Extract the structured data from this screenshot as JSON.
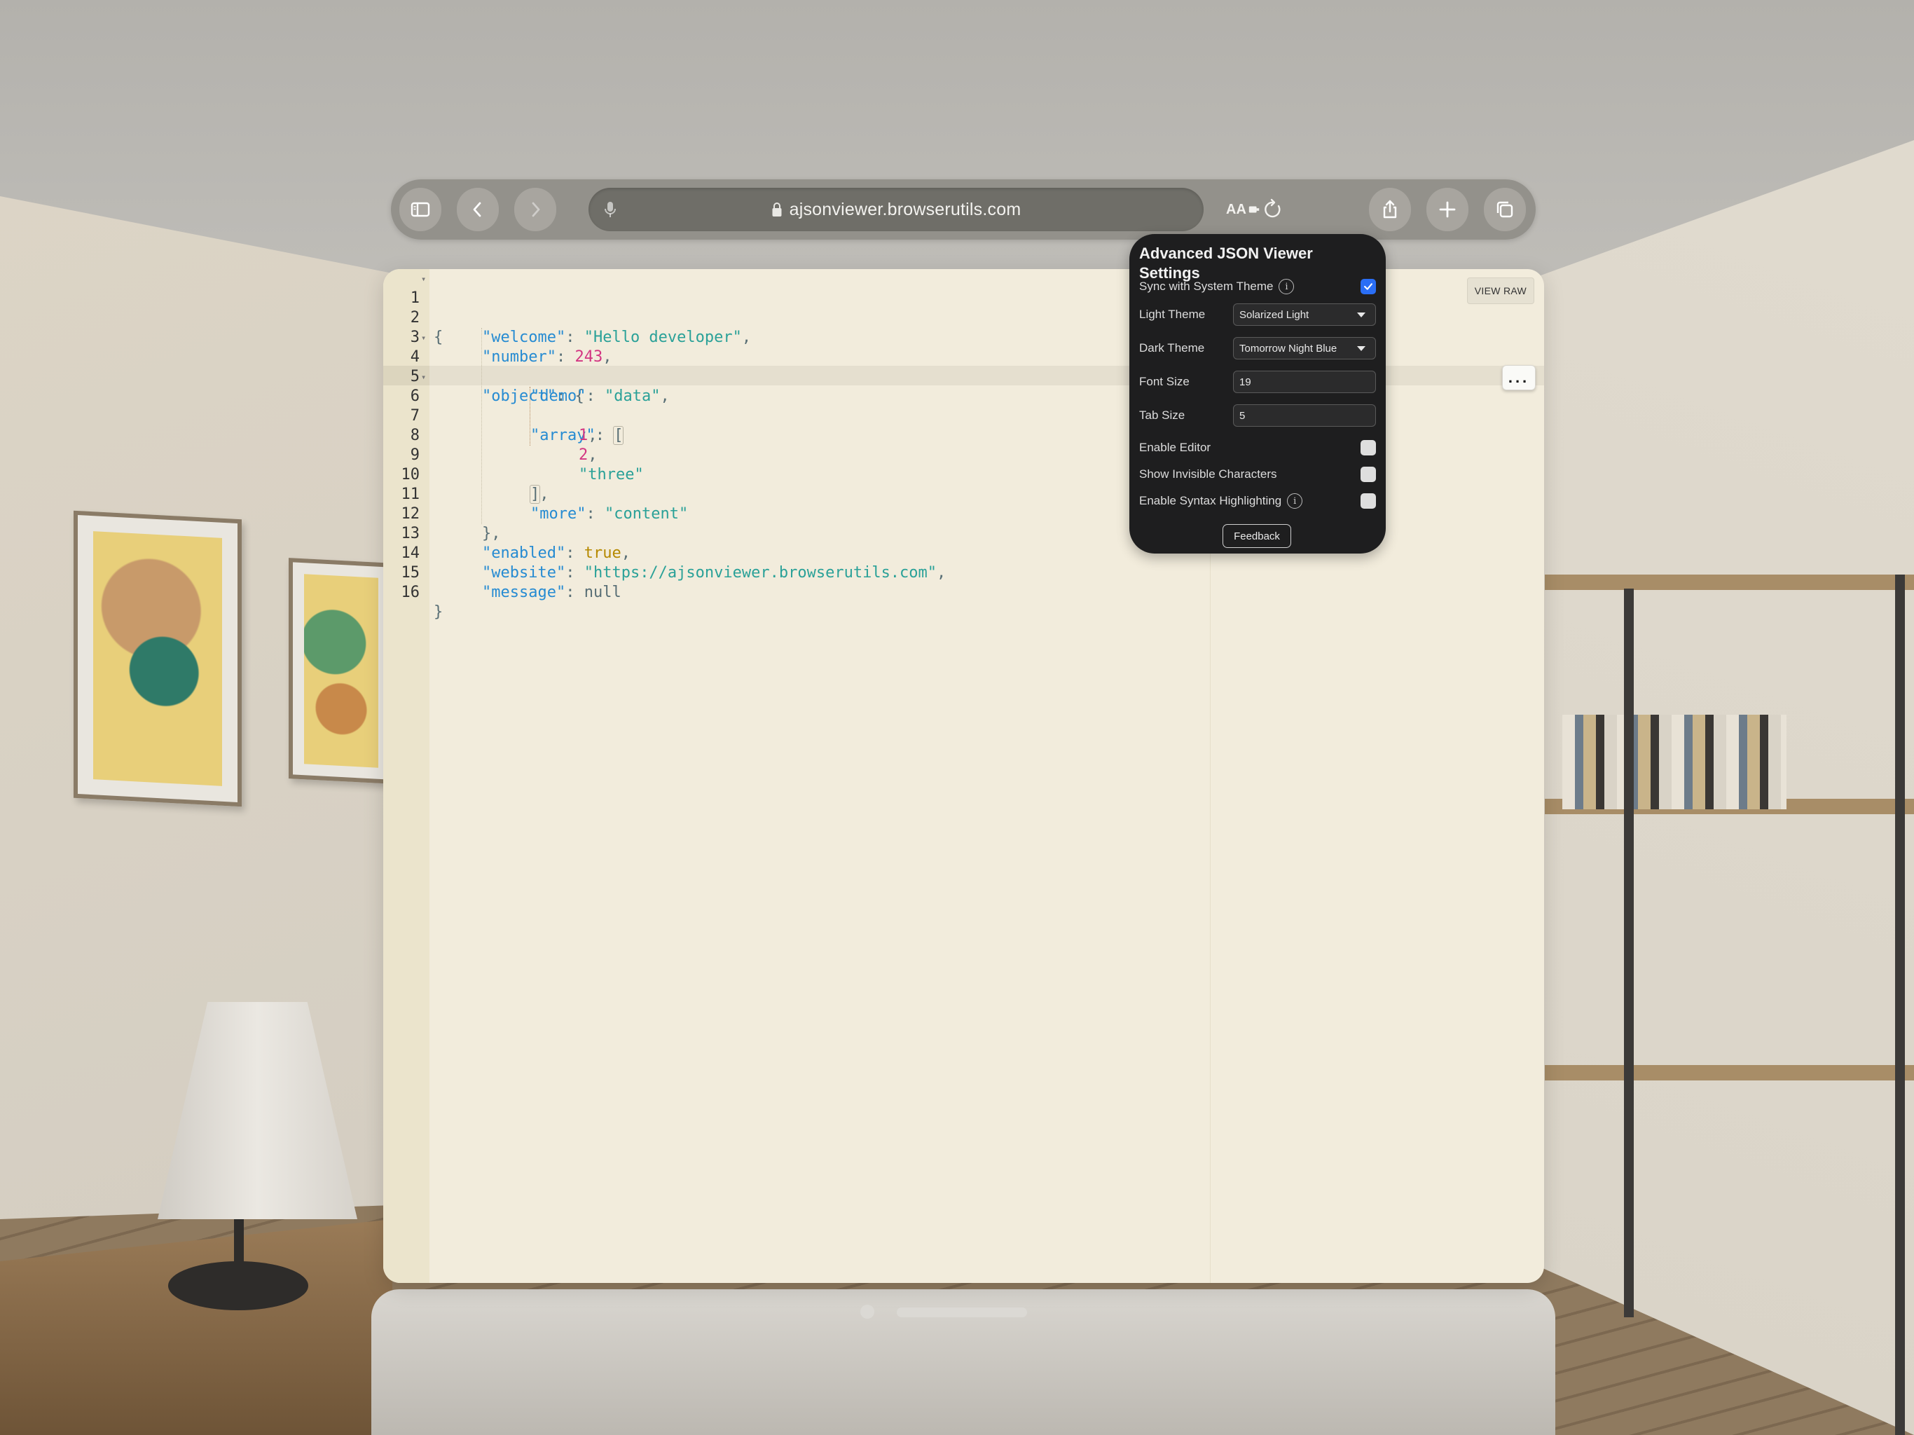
{
  "browser": {
    "url": "ajsonviewer.browserutils.com",
    "reader_label": "AA",
    "buttons": {
      "sidebar": "sidebar-icon",
      "back": "chevron-left-icon",
      "forward": "chevron-right-icon",
      "share": "share-icon",
      "new_tab": "plus-icon",
      "tabs": "tabs-overview-icon"
    }
  },
  "editor": {
    "view_raw_label": "VIEW RAW",
    "more_label": "...",
    "active_line": 6,
    "lines": [
      {
        "n": "1",
        "fold": true
      },
      {
        "n": "2"
      },
      {
        "n": "3"
      },
      {
        "n": "4",
        "fold": true
      },
      {
        "n": "5"
      },
      {
        "n": "6",
        "fold": true
      },
      {
        "n": "7"
      },
      {
        "n": "8"
      },
      {
        "n": "9"
      },
      {
        "n": "10"
      },
      {
        "n": "11"
      },
      {
        "n": "12"
      },
      {
        "n": "13"
      },
      {
        "n": "14"
      },
      {
        "n": "15"
      },
      {
        "n": "16"
      }
    ],
    "tokens": {
      "l1_open": "{",
      "l2_key": "\"welcome\"",
      "l2_val": "\"Hello developer\"",
      "l3_key": "\"number\"",
      "l3_val": "243",
      "l4_key": "\"object\"",
      "l4_open": "{",
      "l5_key": "\"demo\"",
      "l5_val": "\"data\"",
      "l6_key": "\"array\"",
      "l6_open": "[",
      "l7_val": "1",
      "l8_val": "2",
      "l9_val": "\"three\"",
      "l10_close": "]",
      "l11_key": "\"more\"",
      "l11_val": "\"content\"",
      "l12_close": "}",
      "l13_key": "\"enabled\"",
      "l13_val": "true",
      "l14_key": "\"website\"",
      "l14_val": "\"https://ajsonviewer.browserutils.com\"",
      "l15_key": "\"message\"",
      "l15_val": "null",
      "l16_close": "}",
      "colon": ": ",
      "comma": ","
    }
  },
  "settings": {
    "title": "Advanced JSON Viewer Settings",
    "sync_label": "Sync with System Theme",
    "sync_checked": true,
    "light_theme_label": "Light Theme",
    "light_theme_value": "Solarized Light",
    "dark_theme_label": "Dark Theme",
    "dark_theme_value": "Tomorrow Night Blue",
    "font_size_label": "Font Size",
    "font_size_value": "19",
    "tab_size_label": "Tab Size",
    "tab_size_value": "5",
    "enable_editor_label": "Enable Editor",
    "enable_editor_checked": false,
    "show_invisible_label": "Show Invisible Characters",
    "show_invisible_checked": false,
    "syntax_highlight_label": "Enable Syntax Highlighting",
    "syntax_highlight_checked": false,
    "feedback_label": "Feedback",
    "info_glyph": "i"
  },
  "colors": {
    "editor_bg": "#f2ecdc",
    "key": "#268bd2",
    "string": "#2aa198",
    "number": "#d33682",
    "boolean": "#b58900",
    "checkbox_checked": "#2a6ef5",
    "popover_bg": "#1e1e1f"
  }
}
